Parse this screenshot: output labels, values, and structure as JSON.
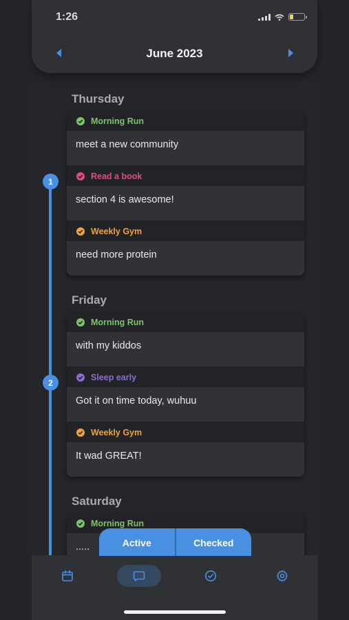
{
  "status_bar": {
    "time": "1:26"
  },
  "header": {
    "month": "June 2023"
  },
  "colors": {
    "accent": "#4a90e2",
    "green": "#7cc36a",
    "pink": "#e14b7f",
    "orange": "#f0a23b",
    "purple": "#8e6bd6"
  },
  "days": [
    {
      "label": "Thursday",
      "marker": "",
      "entries": [
        {
          "habit": "Morning Run",
          "note": "meet a new community",
          "color": "green"
        },
        {
          "habit": "Read a book",
          "note": "section 4 is awesome!",
          "color": "pink"
        },
        {
          "habit": "Weekly Gym",
          "note": "need more protein",
          "color": "orange"
        }
      ]
    },
    {
      "label": "Friday",
      "entries": [
        {
          "habit": "Morning Run",
          "note": "with my kiddos",
          "color": "green"
        },
        {
          "habit": "Sleep early",
          "note": "Got it on time today, wuhuu",
          "color": "purple"
        },
        {
          "habit": "Weekly Gym",
          "note": "It wad GREAT!",
          "color": "orange"
        }
      ]
    },
    {
      "label": "Saturday",
      "entries": [
        {
          "habit": "Morning Run",
          "note": ".....",
          "color": "green"
        }
      ]
    }
  ],
  "timeline_markers": [
    "1",
    "2"
  ],
  "segmented": {
    "active": "Active",
    "checked": "Checked"
  },
  "tabs": [
    {
      "icon": "calendar-icon"
    },
    {
      "icon": "chat-icon",
      "active": true
    },
    {
      "icon": "check-circle-icon"
    },
    {
      "icon": "settings-icon"
    }
  ]
}
